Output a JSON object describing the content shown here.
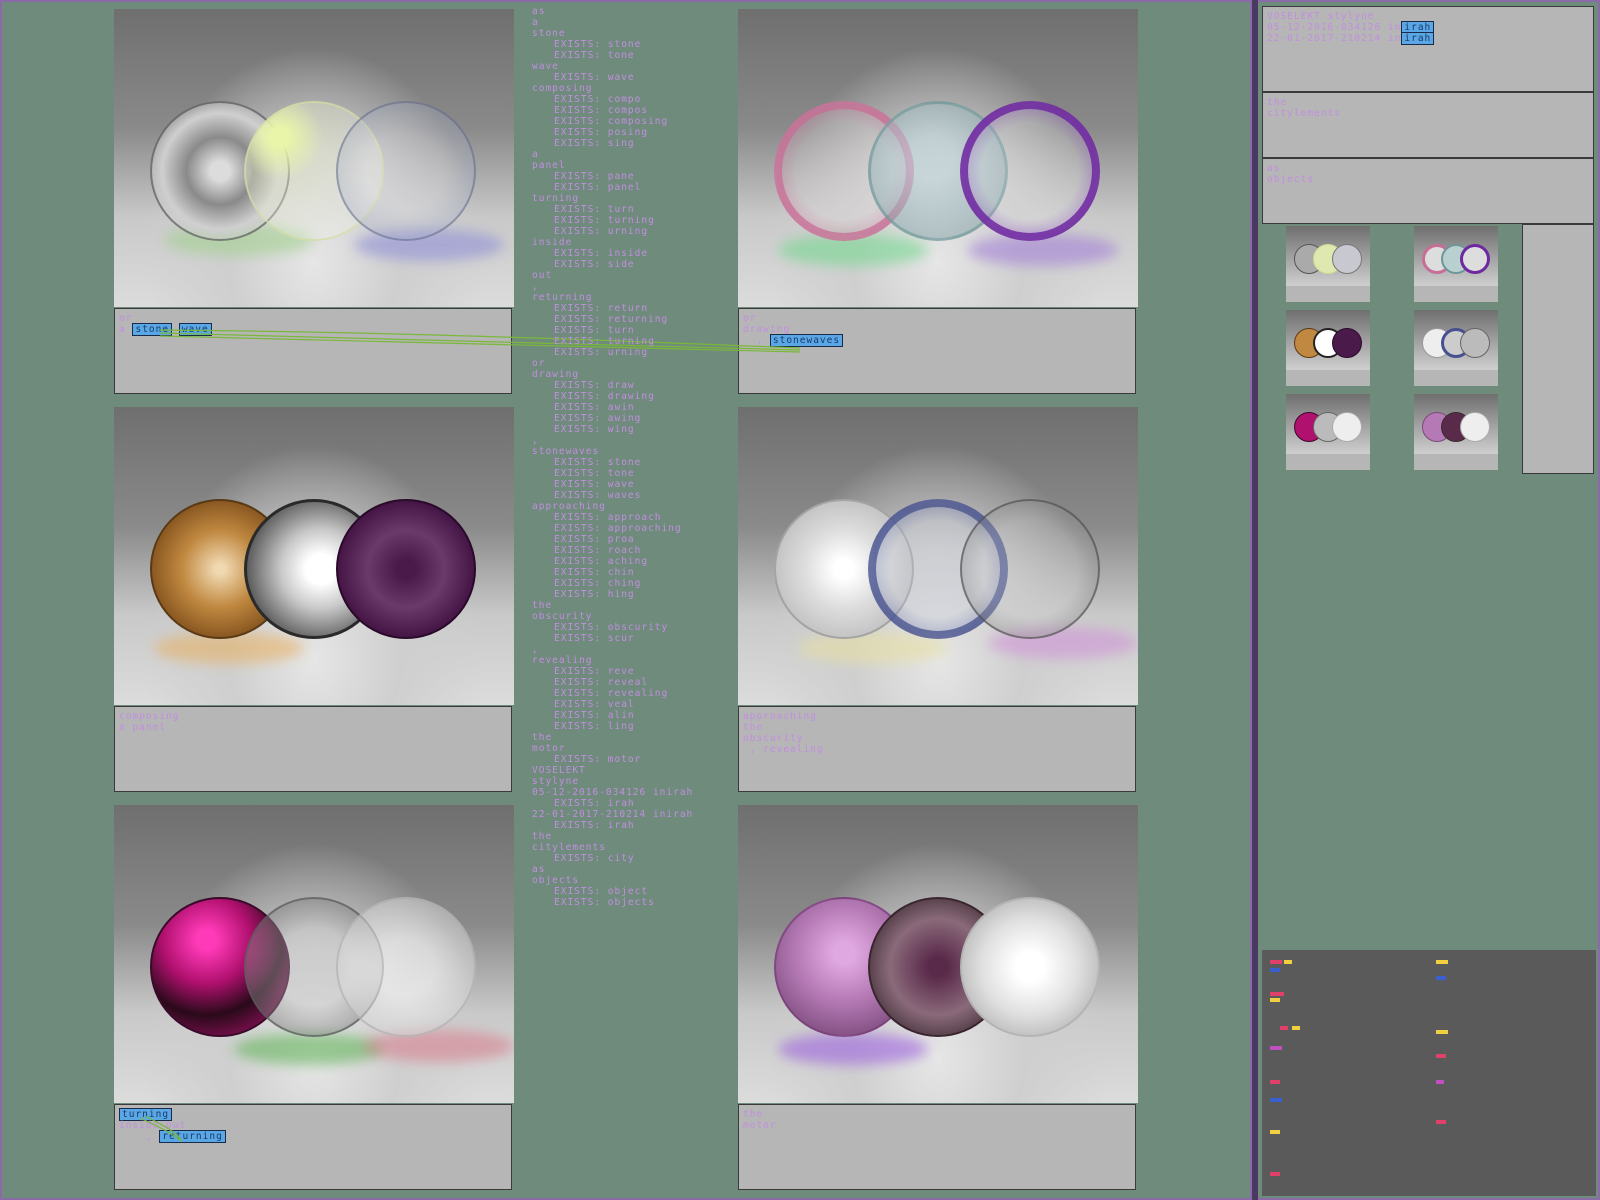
{
  "panels": {
    "p1": {
      "lines": [
        "or",
        "a"
      ],
      "highlights": [
        "stone",
        "wave"
      ]
    },
    "p2": {
      "lines": [
        "or",
        "drawing"
      ],
      "highlights": [
        "stonewaves"
      ]
    },
    "p3": {
      "lines": [
        "composing",
        "a panel"
      ]
    },
    "p4": {
      "lines": [
        "approaching",
        "",
        "the",
        "obscurity",
        " , revealing"
      ]
    },
    "p5": {
      "lines": [
        "turning",
        "inside out",
        "returning"
      ]
    },
    "p6": {
      "lines": [
        "the",
        "motor"
      ]
    }
  },
  "tree": [
    {
      "t": "as",
      "i": 0
    },
    {
      "t": "a",
      "i": 0
    },
    {
      "t": "stone",
      "i": 0
    },
    {
      "t": "EXISTS: stone",
      "i": 1
    },
    {
      "t": "EXISTS: tone",
      "i": 1
    },
    {
      "t": "wave",
      "i": 0
    },
    {
      "t": "EXISTS: wave",
      "i": 1
    },
    {
      "t": "composing",
      "i": 0
    },
    {
      "t": "EXISTS: compo",
      "i": 1
    },
    {
      "t": "EXISTS: compos",
      "i": 1
    },
    {
      "t": "EXISTS: composing",
      "i": 1
    },
    {
      "t": "EXISTS: posing",
      "i": 1
    },
    {
      "t": "EXISTS: sing",
      "i": 1
    },
    {
      "t": "a",
      "i": 0
    },
    {
      "t": "panel",
      "i": 0
    },
    {
      "t": "EXISTS: pane",
      "i": 1
    },
    {
      "t": "EXISTS: panel",
      "i": 1
    },
    {
      "t": "turning",
      "i": 0
    },
    {
      "t": "EXISTS: turn",
      "i": 1
    },
    {
      "t": "EXISTS: turning",
      "i": 1
    },
    {
      "t": "EXISTS: urning",
      "i": 1
    },
    {
      "t": "inside",
      "i": 0
    },
    {
      "t": "EXISTS: inside",
      "i": 1
    },
    {
      "t": "EXISTS: side",
      "i": 1
    },
    {
      "t": "out",
      "i": 0
    },
    {
      "t": ",",
      "i": 0
    },
    {
      "t": "returning",
      "i": 0
    },
    {
      "t": "EXISTS: return",
      "i": 1
    },
    {
      "t": "EXISTS: returning",
      "i": 1
    },
    {
      "t": "EXISTS: turn",
      "i": 1
    },
    {
      "t": "EXISTS: turning",
      "i": 1
    },
    {
      "t": "EXISTS: urning",
      "i": 1
    },
    {
      "t": "or",
      "i": 0
    },
    {
      "t": "drawing",
      "i": 0
    },
    {
      "t": "EXISTS: draw",
      "i": 1
    },
    {
      "t": "EXISTS: drawing",
      "i": 1
    },
    {
      "t": "EXISTS: awin",
      "i": 1
    },
    {
      "t": "EXISTS: awing",
      "i": 1
    },
    {
      "t": "EXISTS: wing",
      "i": 1
    },
    {
      "t": ",",
      "i": 0
    },
    {
      "t": "stonewaves",
      "i": 0
    },
    {
      "t": "EXISTS: stone",
      "i": 1
    },
    {
      "t": "EXISTS: tone",
      "i": 1
    },
    {
      "t": "EXISTS: wave",
      "i": 1
    },
    {
      "t": "EXISTS: waves",
      "i": 1
    },
    {
      "t": "approaching",
      "i": 0
    },
    {
      "t": "EXISTS: approach",
      "i": 1
    },
    {
      "t": "EXISTS: approaching",
      "i": 1
    },
    {
      "t": "EXISTS: proa",
      "i": 1
    },
    {
      "t": "EXISTS: roach",
      "i": 1
    },
    {
      "t": "EXISTS: aching",
      "i": 1
    },
    {
      "t": "EXISTS: chin",
      "i": 1
    },
    {
      "t": "EXISTS: ching",
      "i": 1
    },
    {
      "t": "EXISTS: hing",
      "i": 1
    },
    {
      "t": "the",
      "i": 0
    },
    {
      "t": "obscurity",
      "i": 0
    },
    {
      "t": "EXISTS: obscurity",
      "i": 1
    },
    {
      "t": "EXISTS: scur",
      "i": 1
    },
    {
      "t": ",",
      "i": 0
    },
    {
      "t": "revealing",
      "i": 0
    },
    {
      "t": "EXISTS: reve",
      "i": 1
    },
    {
      "t": "EXISTS: reveal",
      "i": 1
    },
    {
      "t": "EXISTS: revealing",
      "i": 1
    },
    {
      "t": "EXISTS: veal",
      "i": 1
    },
    {
      "t": "EXISTS: alin",
      "i": 1
    },
    {
      "t": "EXISTS: ling",
      "i": 1
    },
    {
      "t": "the",
      "i": 0
    },
    {
      "t": "motor",
      "i": 0
    },
    {
      "t": "EXISTS: motor",
      "i": 1
    },
    {
      "t": "VOSELEKT",
      "i": 0
    },
    {
      "t": "stylyne",
      "i": 0
    },
    {
      "t": "05-12-2016-034126 inirah",
      "i": 0
    },
    {
      "t": "EXISTS: irah",
      "i": 1
    },
    {
      "t": "22-01-2017-210214 inirah",
      "i": 0
    },
    {
      "t": "EXISTS: irah",
      "i": 1
    },
    {
      "t": "the",
      "i": 0
    },
    {
      "t": "citylements",
      "i": 0
    },
    {
      "t": "EXISTS: city",
      "i": 1
    },
    {
      "t": "as",
      "i": 0
    },
    {
      "t": "objects",
      "i": 0
    },
    {
      "t": "EXISTS: object",
      "i": 1
    },
    {
      "t": "EXISTS: objects",
      "i": 1
    }
  ],
  "side": {
    "title": "VOSELEKT stylyne",
    "entries": [
      {
        "text": "05-12-2016-034126 in",
        "hl": "irah"
      },
      {
        "text": "22-01-2017-210214 in",
        "hl": "irah"
      }
    ],
    "box2": [
      "the",
      "citylements"
    ],
    "box3": [
      "as",
      "objects"
    ]
  },
  "colors": {
    "background": "#6f8b7c",
    "panel": "#b6b6b6",
    "text": "#c28ee0",
    "highlight": "#5aa7e6",
    "link": "#7ab83a"
  }
}
